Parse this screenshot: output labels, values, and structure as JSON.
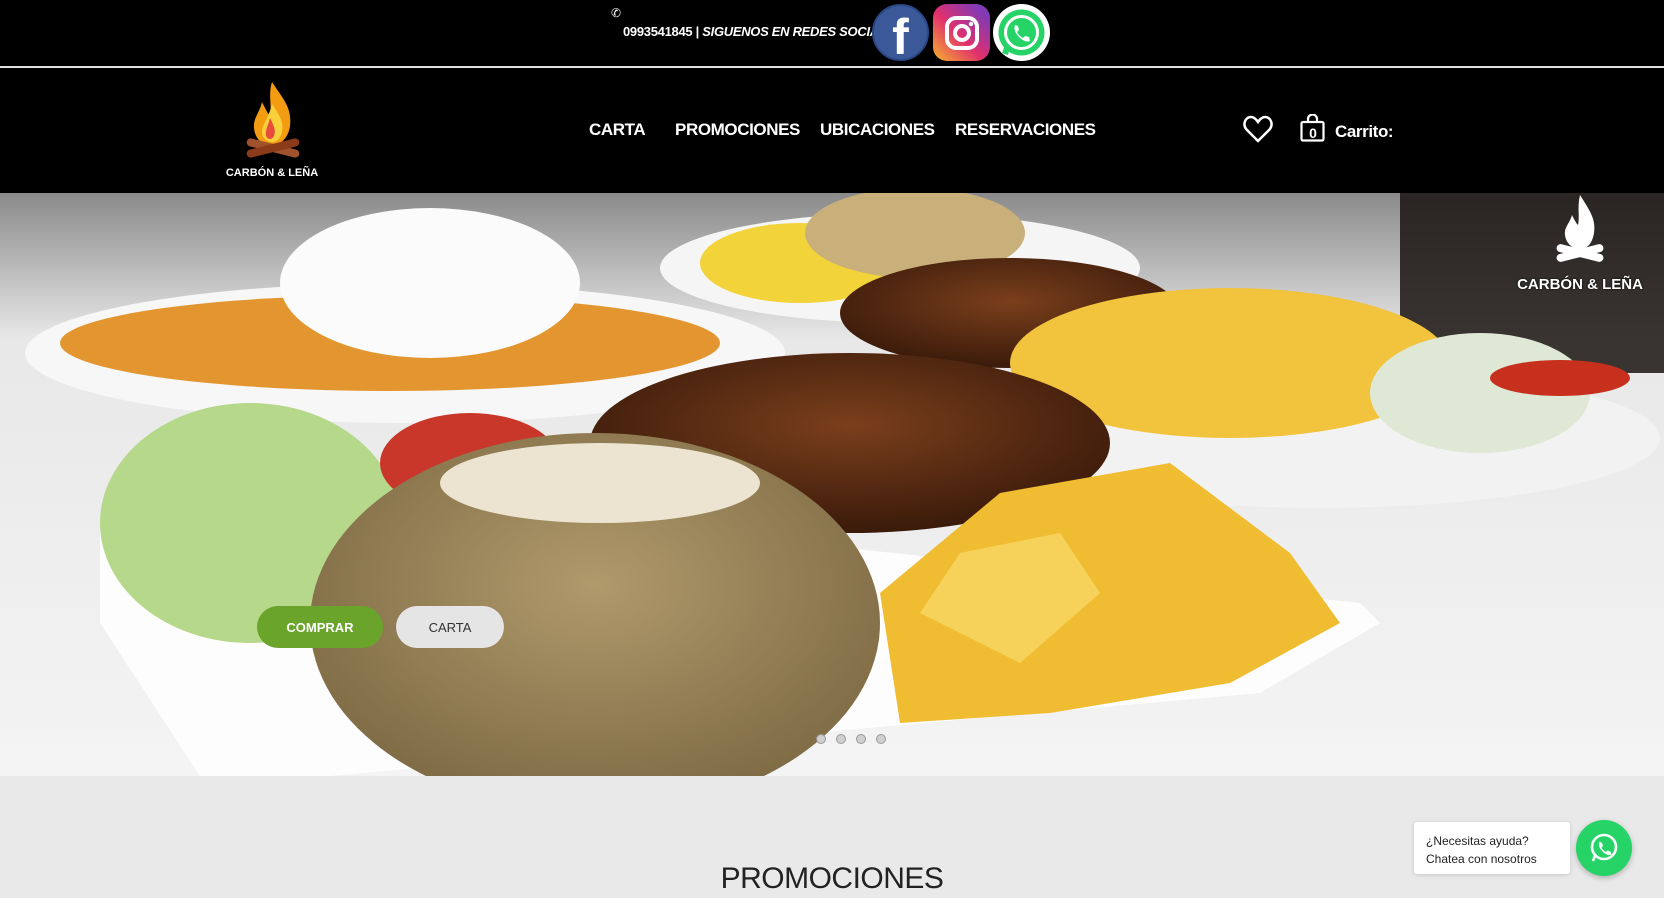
{
  "topbar": {
    "phone_icon": "phone-icon",
    "phone": "0993541845 |",
    "social_text": "SIGUENOS EN REDES SOCIALES",
    "separator": "|",
    "facebook_icon": "facebook-icon",
    "instagram_icon": "instagram-icon",
    "whatsapp_icon": "whatsapp-icon"
  },
  "brand": {
    "name": "CARBÓN & LEÑA",
    "logo_icon": "flame-logo-icon"
  },
  "nav": {
    "items": [
      "CARTA",
      "PROMOCIONES",
      "UBICACIONES",
      "RESERVACIONES"
    ]
  },
  "header_actions": {
    "wishlist_icon": "heart-icon",
    "cart_icon": "shopping-bag-icon",
    "cart_count": "0",
    "cart_label": "Carrito:"
  },
  "hero": {
    "watermark": "CARBÓN & LEÑA",
    "buttons": {
      "buy": "COMPRAR",
      "menu": "CARTA"
    },
    "slides_count": 4,
    "active_slide": 0
  },
  "section": {
    "title": "PROMOCIONES"
  },
  "help_widget": {
    "line1": "¿Necesitas ayuda?",
    "line2": "Chatea con nosotros",
    "icon": "whatsapp-icon"
  },
  "colors": {
    "topbar_bg": "#000000",
    "buy_button": "#6aa42a",
    "whatsapp": "#25d366",
    "facebook": "#3b5998",
    "page_bg": "#e9e9e9"
  }
}
